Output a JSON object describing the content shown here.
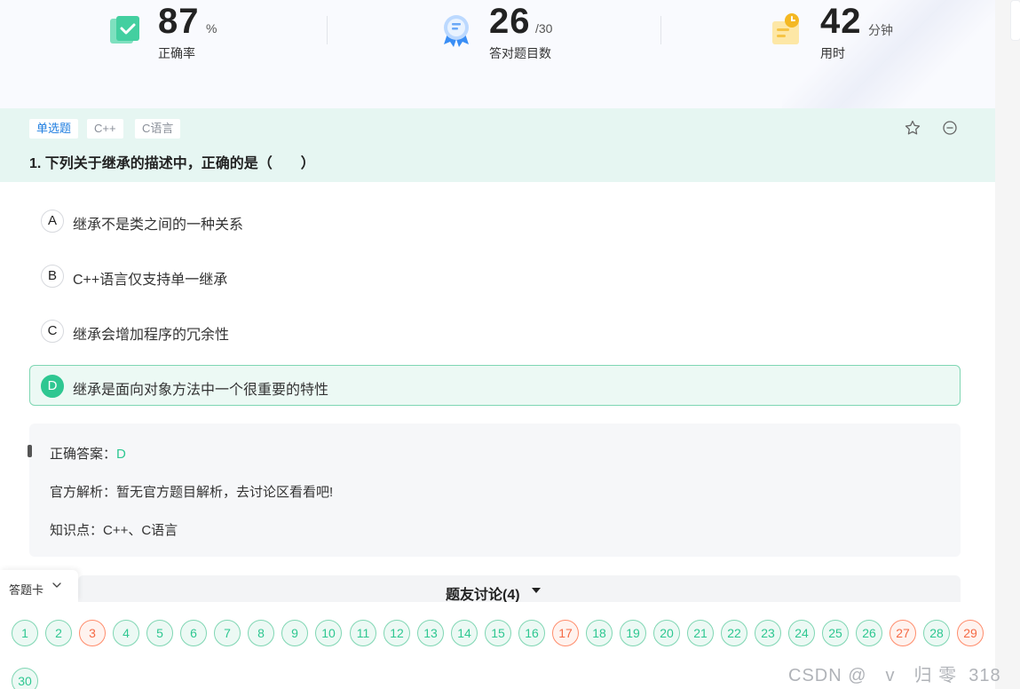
{
  "stats": [
    {
      "value": "87",
      "unit": "%",
      "label": "正确率",
      "icon": "checkbook-icon"
    },
    {
      "value": "26",
      "unit": "/30",
      "label": "答对题目数",
      "icon": "award-ribbon-icon"
    },
    {
      "value": "42",
      "unit": "分钟",
      "label": "用时",
      "icon": "clock-note-icon"
    }
  ],
  "question": {
    "type_tag": "单选题",
    "tags": [
      "C++",
      "C语言"
    ],
    "title": "1. 下列关于继承的描述中，正确的是（　　）",
    "options": [
      {
        "letter": "A",
        "text": "继承不是类之间的一种关系",
        "correct": false
      },
      {
        "letter": "B",
        "text": "C++语言仅支持单一继承",
        "correct": false
      },
      {
        "letter": "C",
        "text": "继承会增加程序的冗余性",
        "correct": false
      },
      {
        "letter": "D",
        "text": "继承是面向对象方法中一个很重要的特性",
        "correct": true
      }
    ]
  },
  "analysis": {
    "answer_label": "正确答案：",
    "answer_value": "D",
    "official": "官方解析：暂无官方题目解析，去讨论区看看吧!",
    "knowledge": "知识点：C++、C语言"
  },
  "discussion": {
    "title": "题友讨论(4)"
  },
  "answer_card": {
    "label": "答题卡",
    "numbers": [
      "1",
      "2",
      "3",
      "4",
      "5",
      "6",
      "7",
      "8",
      "9",
      "10",
      "11",
      "12",
      "13",
      "14",
      "15",
      "16",
      "17",
      "18",
      "19",
      "20",
      "21",
      "22",
      "23",
      "24",
      "25",
      "26",
      "27",
      "28",
      "29",
      "30"
    ],
    "wrong": [
      "3",
      "17",
      "27",
      "29"
    ]
  },
  "watermark": "CSDN @　v　归 零  318",
  "colors": {
    "accent": "#2ec791",
    "wrong": "#f56a45",
    "link": "#1f7ee0",
    "header_bg": "#e6f6f2"
  }
}
